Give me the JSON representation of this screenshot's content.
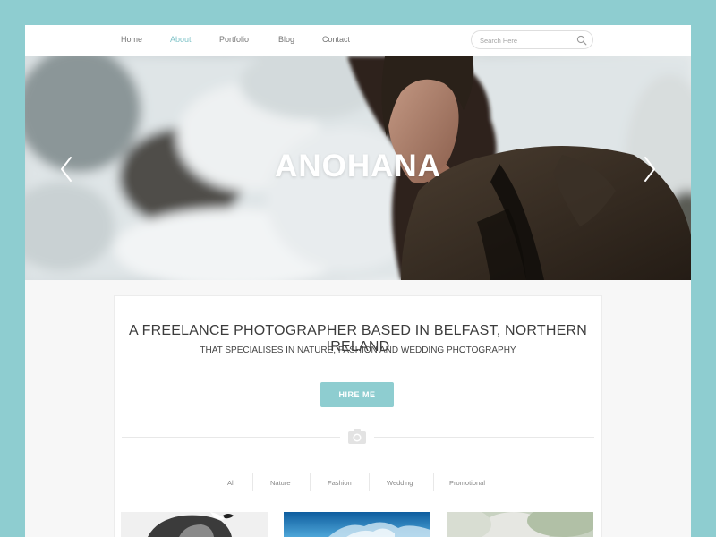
{
  "nav": {
    "items": [
      {
        "label": "Home",
        "active": false
      },
      {
        "label": "About",
        "active": true
      },
      {
        "label": "Portfolio",
        "active": false
      },
      {
        "label": "Blog",
        "active": false
      },
      {
        "label": "Contact",
        "active": false
      }
    ],
    "search_placeholder": "Search Here",
    "search_icon": "search-icon"
  },
  "hero": {
    "title": "ANOHANA",
    "prev_icon": "chevron-left-icon",
    "next_icon": "chevron-right-icon"
  },
  "intro": {
    "headline": "A FREELANCE PHOTOGRAPHER BASED IN BELFAST, NORTHERN IRELAND",
    "subheadline": "THAT SPECIALISES IN NATURE, FASHION AND WEDDING PHOTOGRAPHY",
    "hire_label": "HIRE ME"
  },
  "divider_icon": "camera-icon",
  "filters": [
    "All",
    "Nature",
    "Fashion",
    "Wedding",
    "Promotional"
  ],
  "colors": {
    "background": "#8ecdd0",
    "accent": "#7fc3c8",
    "button": "#8ecdd0",
    "text_dark": "#3c3c3c",
    "nav_text": "#777777"
  }
}
